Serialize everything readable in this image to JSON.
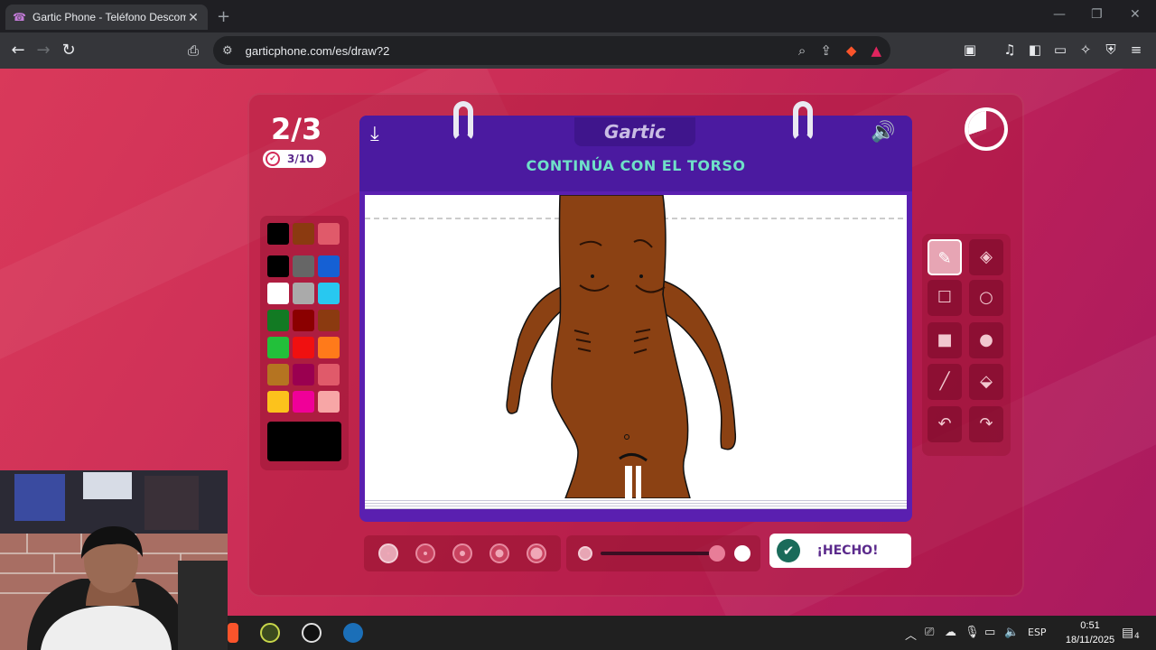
{
  "browser": {
    "tab_title": "Gartic Phone - Teléfono Descom",
    "tab_close": "✕",
    "new_tab": "+",
    "url": "garticphone.com/es/draw?2",
    "minimize": "—",
    "restore": "❐",
    "close": "✕"
  },
  "game": {
    "round": "2/3",
    "players_done": "3/10",
    "logo": "Gartic",
    "prompt": "CONTINÚA CON EL TORSO",
    "done_label": "¡HECHO!",
    "timer_remaining_fraction": 0.7
  },
  "palette": {
    "colors": [
      "#000000",
      "#8b3a10",
      "#e05a6a",
      "#000000",
      "#666666",
      "#1560d4",
      "#ffffff",
      "#aaaaaa",
      "#28c8f0",
      "#127a23",
      "#8b0000",
      "#8b3a10",
      "#22c03a",
      "#f01010",
      "#ff7a1a",
      "#b57421",
      "#9a0050",
      "#e05a6a",
      "#fcc21c",
      "#f00098",
      "#f7a6a6"
    ],
    "current_color": "#000000"
  },
  "tools": [
    "pencil",
    "eraser",
    "rectangle-outline",
    "ellipse-outline",
    "rectangle-filled",
    "ellipse-filled",
    "line",
    "fill-bucket",
    "undo",
    "redo"
  ],
  "brush_size_selected": 1,
  "opacity_fraction": 1.0,
  "taskbar": {
    "language": "ESP",
    "time": "0:51",
    "date": "18/11/2025",
    "notifications": "4"
  }
}
